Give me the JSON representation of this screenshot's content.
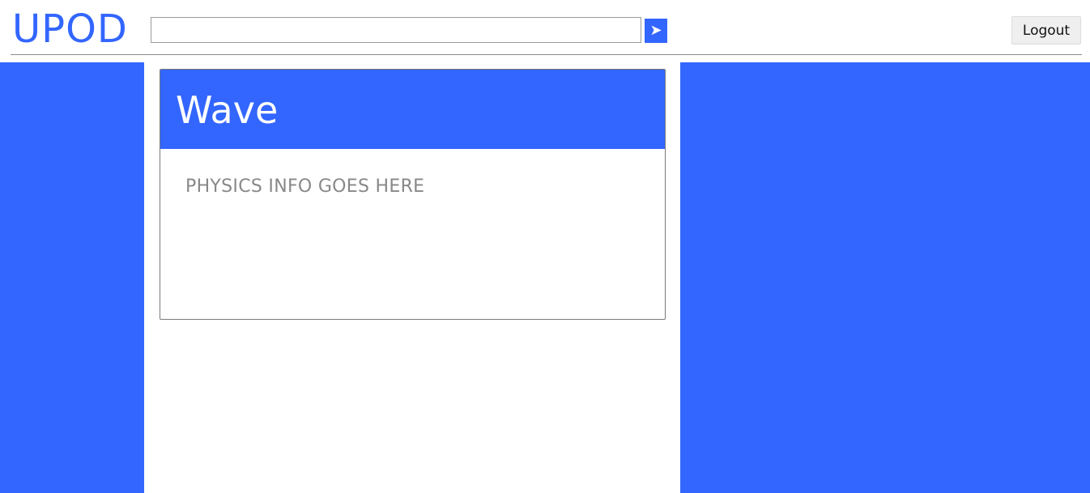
{
  "header": {
    "logo": "UPOD",
    "search": {
      "value": "",
      "placeholder": "",
      "submit_glyph": "➤"
    },
    "logout_label": "Logout"
  },
  "card": {
    "title": "Wave",
    "body": "PHYSICS INFO GOES HERE"
  },
  "colors": {
    "accent": "#3366ff",
    "muted_text": "#888888"
  },
  "icons": {
    "search_submit": "arrow-right-icon"
  }
}
